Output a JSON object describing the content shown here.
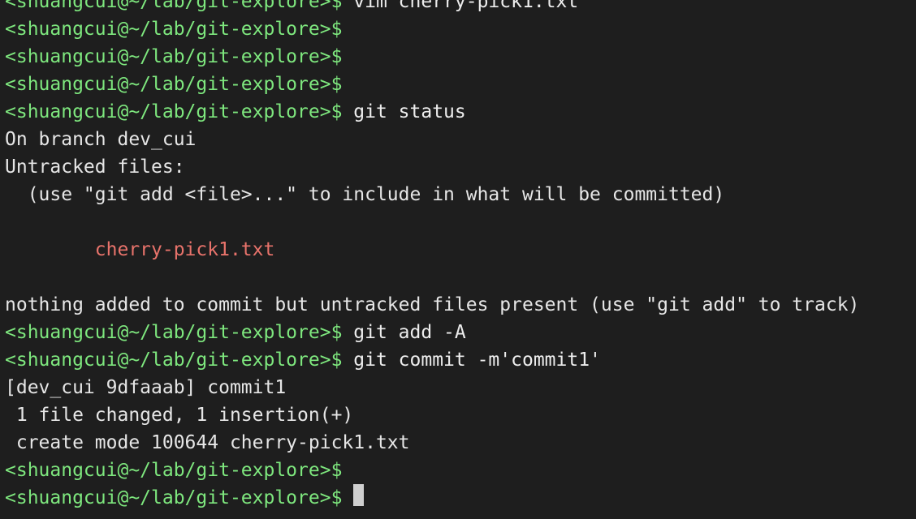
{
  "terminal": {
    "prompt": "<shuangcui@~/lab/git-explore>$",
    "lines": [
      {
        "kind": "prompt",
        "cmd": " vim cherry-pick1.txt"
      },
      {
        "kind": "prompt",
        "cmd": ""
      },
      {
        "kind": "prompt",
        "cmd": ""
      },
      {
        "kind": "prompt",
        "cmd": ""
      },
      {
        "kind": "prompt",
        "cmd": " git status"
      },
      {
        "kind": "out",
        "text": "On branch dev_cui"
      },
      {
        "kind": "out",
        "text": "Untracked files:"
      },
      {
        "kind": "out",
        "text": "  (use \"git add <file>...\" to include in what will be committed)"
      },
      {
        "kind": "out",
        "text": ""
      },
      {
        "kind": "untracked",
        "text": "        cherry-pick1.txt"
      },
      {
        "kind": "out",
        "text": ""
      },
      {
        "kind": "out",
        "text": "nothing added to commit but untracked files present (use \"git add\" to track)"
      },
      {
        "kind": "prompt",
        "cmd": " git add -A"
      },
      {
        "kind": "prompt",
        "cmd": " git commit -m'commit1'"
      },
      {
        "kind": "out",
        "text": "[dev_cui 9dfaaab] commit1"
      },
      {
        "kind": "out",
        "text": " 1 file changed, 1 insertion(+)"
      },
      {
        "kind": "out",
        "text": " create mode 100644 cherry-pick1.txt"
      },
      {
        "kind": "prompt",
        "cmd": ""
      },
      {
        "kind": "prompt",
        "cmd": " ",
        "cursor": true
      }
    ]
  }
}
